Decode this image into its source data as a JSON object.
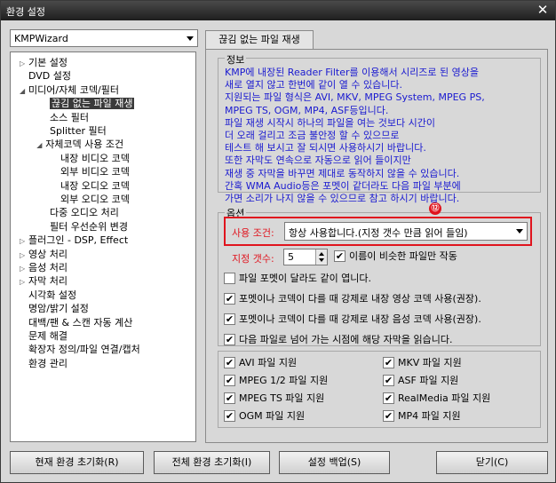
{
  "window": {
    "title": "환경 설정"
  },
  "profile": {
    "value": "KMPWizard"
  },
  "tree": [
    {
      "label": "기본 설정"
    },
    {
      "label": "DVD 설정"
    },
    {
      "label": "미디어/자체 코덱/필터"
    },
    {
      "label": "끊김 없는 파일 재생"
    },
    {
      "label": "소스 필터"
    },
    {
      "label": "Splitter 필터"
    },
    {
      "label": "자체코덱 사용 조건"
    },
    {
      "label": "내장 비디오 코덱"
    },
    {
      "label": "외부 비디오 코덱"
    },
    {
      "label": "내장 오디오 코덱"
    },
    {
      "label": "외부 오디오 코덱"
    },
    {
      "label": "다중 오디오 처리"
    },
    {
      "label": "필터 우선순위 변경"
    },
    {
      "label": "플러그인 - DSP, Effect"
    },
    {
      "label": "영상 처리"
    },
    {
      "label": "음성 처리"
    },
    {
      "label": "자막 처리"
    },
    {
      "label": "시각화 설정"
    },
    {
      "label": "명암/밝기 설정"
    },
    {
      "label": "대백/팬 & 스캔 자동 계산"
    },
    {
      "label": "문제 해결"
    },
    {
      "label": "확장자 정의/파일 연결/캡처"
    },
    {
      "label": "환경 관리"
    }
  ],
  "tab": {
    "label": "끊김 없는 파일 재생"
  },
  "info": {
    "title": "정보",
    "lines": [
      "KMP에 내장된 Reader Filter를 이용해서 시리즈로 된 영상을",
      "새로 열지 않고 한번에 같이 열 수 있습니다.",
      "지원되는 파일 형식은 AVI, MKV, MPEG System, MPEG PS,",
      "MPEG TS, OGM, MP4, ASF등입니다.",
      "파일 재생 시작시 하나의 파일을 여는 것보다 시간이",
      "더 오래 걸리고 조금 불안정 할 수 있으므로",
      "테스트 해 보시고 잘 되시면 사용하시기 바랍니다.",
      "또한 자막도 연속으로 자동으로 읽어 들이지만",
      "재생 중 자막을 바꾸면 제대로 동작하지 않을 수 있습니다.",
      "간혹 WMA Audio등은 포멧이 같더라도 다음 파일 부분에",
      "가면 소리가 나지 않을 수 있으므로 참고 하시기 바랍니다."
    ]
  },
  "options": {
    "title": "옵션",
    "badge": "⑫",
    "usage_label": "사용 조건:",
    "usage_value": "항상 사용합니다.(지정 갯수 만큼 읽어 들임)",
    "count_label": "지정 갯수:",
    "count_value": "5",
    "similar_name": {
      "label": "이름이 비슷한 파일만 작동",
      "checked": true
    },
    "checks": [
      {
        "label": "파일 포멧이 달라도 같이 엽니다.",
        "checked": false
      },
      {
        "label": "포멧이나 코덱이 다를 때 강제로 내장 영상 코덱 사용(권장).",
        "checked": true
      },
      {
        "label": "포멧이나 코덱이 다를 때 강제로 내장 음성 코덱 사용(권장).",
        "checked": true
      },
      {
        "label": "다음 파일로 넘어 가는 시점에 해당 자막을 읽습니다.",
        "checked": true
      }
    ],
    "formats": [
      {
        "label": "AVI 파일 지원",
        "checked": true
      },
      {
        "label": "MKV 파일 지원",
        "checked": true
      },
      {
        "label": "MPEG 1/2 파일 지원",
        "checked": true
      },
      {
        "label": "ASF 파일 지원",
        "checked": true
      },
      {
        "label": "MPEG TS 파일 지원",
        "checked": true
      },
      {
        "label": "RealMedia 파일 지원",
        "checked": true
      },
      {
        "label": "OGM 파일 지원",
        "checked": true
      },
      {
        "label": "MP4 파일 지원",
        "checked": true
      }
    ]
  },
  "buttons": {
    "reset_current": "현재 환경 초기화(R)",
    "reset_all": "전체 환경 초기화(I)",
    "backup": "설정 백업(S)",
    "close": "닫기(C)"
  },
  "glyphs": {
    "close": "✕",
    "check": "✔"
  },
  "colors": {
    "info_text": "#1a1ad0",
    "highlight": "#e0141e",
    "selection": "#3a3a3a"
  }
}
